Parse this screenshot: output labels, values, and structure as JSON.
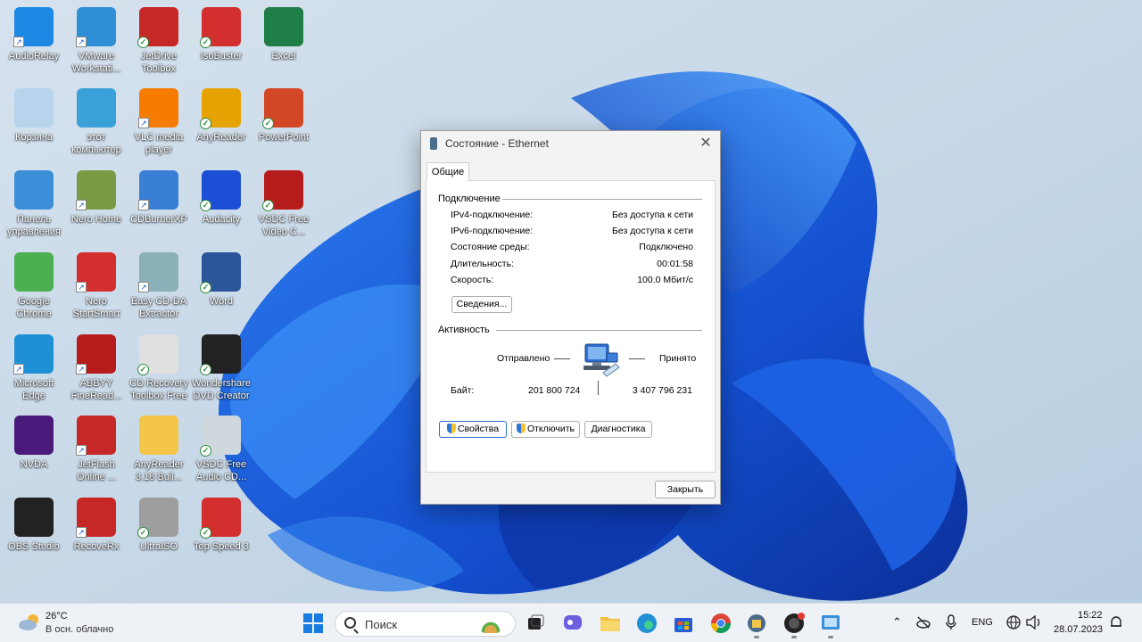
{
  "desktop": {
    "icons": [
      {
        "label": "AudioRelay",
        "color": "#1e88e5",
        "badge": "shortcut"
      },
      {
        "label": "VMware Workstati...",
        "color": "#2f8fd6",
        "badge": "shortcut"
      },
      {
        "label": "JetDrive Toolbox",
        "color": "#c62828",
        "badge": "sync"
      },
      {
        "label": "IsoBuster",
        "color": "#d32f2f",
        "badge": "sync"
      },
      {
        "label": "Excel",
        "color": "#1e7e45",
        "badge": "none"
      },
      {
        "label": "Корзина",
        "color": "#b8d4ec",
        "badge": "none"
      },
      {
        "label": "этот компьютер",
        "color": "#3aa0d8",
        "badge": "none"
      },
      {
        "label": "VLC media player",
        "color": "#f57c00",
        "badge": "shortcut"
      },
      {
        "label": "AnyReader",
        "color": "#e6a200",
        "badge": "sync"
      },
      {
        "label": "PowerPoint",
        "color": "#d24726",
        "badge": "sync"
      },
      {
        "label": "Панель управления",
        "color": "#3b8fd8",
        "badge": "none"
      },
      {
        "label": "Nero Home",
        "color": "#7a9a44",
        "badge": "shortcut"
      },
      {
        "label": "CDBurnerXP",
        "color": "#3a7fd6",
        "badge": "shortcut"
      },
      {
        "label": "Audacity",
        "color": "#1b4fd6",
        "badge": "sync"
      },
      {
        "label": "VSDC Free Video C...",
        "color": "#b71c1c",
        "badge": "sync"
      },
      {
        "label": "Google Chrome",
        "color": "#4caf50",
        "badge": "none"
      },
      {
        "label": "Nero StartSmart",
        "color": "#d32f2f",
        "badge": "shortcut"
      },
      {
        "label": "Easy CD-DA Extractor",
        "color": "#8ab0b8",
        "badge": "shortcut"
      },
      {
        "label": "Word",
        "color": "#2b579a",
        "badge": "sync"
      },
      {
        "label": "Microsoft Edge",
        "color": "#1f8fd6",
        "badge": "shortcut"
      },
      {
        "label": "ABBYY FineRead...",
        "color": "#b71c1c",
        "badge": "shortcut"
      },
      {
        "label": "CD Recovery Toolbox Free",
        "color": "#e0e0e0",
        "badge": "sync"
      },
      {
        "label": "Wondershare DVD Creator",
        "color": "#222222",
        "badge": "sync"
      },
      {
        "label": "NVDA",
        "color": "#4a1a7a",
        "badge": "none"
      },
      {
        "label": "JetFlash Online ...",
        "color": "#c62828",
        "badge": "shortcut"
      },
      {
        "label": "AnyReader 3.18 Buil...",
        "color": "#f3c64a",
        "badge": "none"
      },
      {
        "label": "VSDC Free Audio CD...",
        "color": "#cfd8dc",
        "badge": "sync"
      },
      {
        "label": "OBS Studio",
        "color": "#222222",
        "badge": "none"
      },
      {
        "label": "RecoveRx",
        "color": "#c62828",
        "badge": "shortcut"
      },
      {
        "label": "UltraISO",
        "color": "#9e9e9e",
        "badge": "sync"
      },
      {
        "label": "Top Speed 3",
        "color": "#d32f2f",
        "badge": "sync"
      }
    ]
  },
  "dialog": {
    "title": "Состояние - Ethernet",
    "tab": "Общие",
    "connection_group": "Подключение",
    "rows": [
      {
        "key": "IPv4-подключение:",
        "value": "Без доступа к сети"
      },
      {
        "key": "IPv6-подключение:",
        "value": "Без доступа к сети"
      },
      {
        "key": "Состояние среды:",
        "value": "Подключено"
      },
      {
        "key": "Длительность:",
        "value": "00:01:58"
      },
      {
        "key": "Скорость:",
        "value": "100.0 Мбит/с"
      }
    ],
    "details_button": "Сведения...",
    "activity_group": "Активность",
    "sent_label": "Отправлено",
    "received_label": "Принято",
    "bytes_label": "Байт:",
    "bytes_sent": "201 800 724",
    "bytes_received": "3 407 796 231",
    "properties_button": "Свойства",
    "disable_button": "Отключить",
    "diagnostics_button": "Диагностика",
    "close_button": "Закрыть"
  },
  "taskbar": {
    "weather_temp": "26°C",
    "weather_desc": "В осн. облачно",
    "search_placeholder": "Поиск",
    "language": "ENG",
    "time": "15:22",
    "date": "28.07.2023"
  },
  "colors": {
    "accent": "#2a6ec9",
    "wallpaper_blue": "#1a56d6"
  }
}
